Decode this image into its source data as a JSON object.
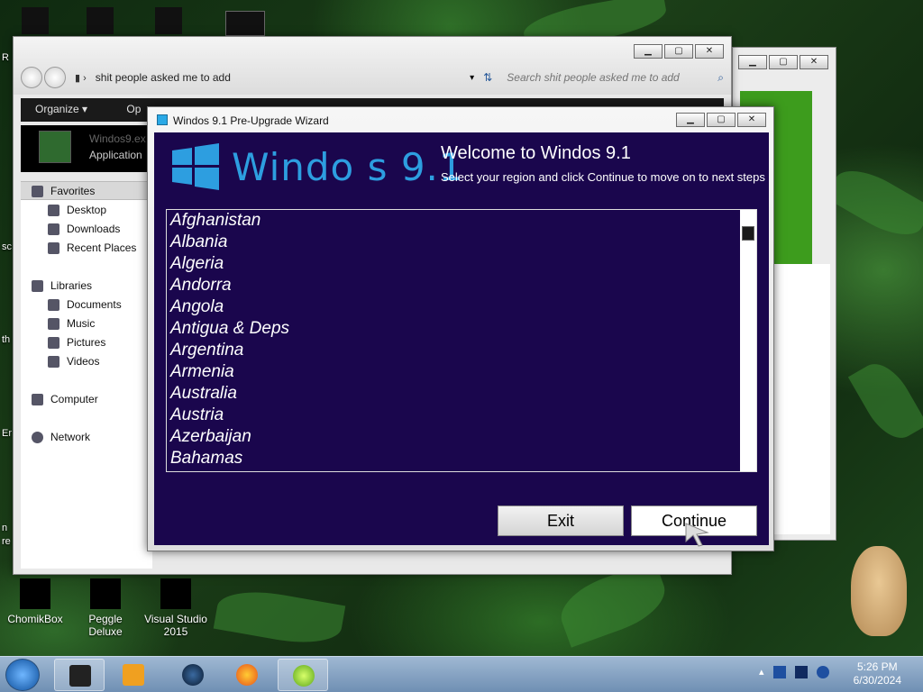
{
  "desktop": {
    "icons": [
      {
        "label": "ChomikBox"
      },
      {
        "label": "Peggle Deluxe"
      },
      {
        "label": "Visual Studio 2015"
      }
    ],
    "edge_text": [
      "R",
      "sc",
      "th",
      "Er",
      "n",
      "re"
    ]
  },
  "explorer": {
    "breadcrumb": "shit people asked me to add",
    "search_placeholder": "Search shit people asked me to add",
    "toolbar": {
      "organize": "Organize",
      "open": "Op"
    },
    "detail": {
      "name": "Windos9.ex",
      "type": "Application"
    },
    "sidebar": {
      "favorites": "Favorites",
      "favorite_items": [
        "Desktop",
        "Downloads",
        "Recent Places"
      ],
      "libraries": "Libraries",
      "library_items": [
        "Documents",
        "Music",
        "Pictures",
        "Videos"
      ],
      "computer": "Computer",
      "network": "Network"
    }
  },
  "wizard": {
    "title": "Windos 9.1 Pre-Upgrade Wizard",
    "logo_text": "Windo  s 9.1",
    "heading": "Welcome to Windos 9.1",
    "subtitle": "Select your region and click Continue to move on to next steps",
    "countries": [
      "Afghanistan",
      "Albania",
      "Algeria",
      "Andorra",
      "Angola",
      "Antigua & Deps",
      "Argentina",
      "Armenia",
      "Australia",
      "Austria",
      "Azerbaijan",
      "Bahamas"
    ],
    "exit_label": "Exit",
    "continue_label": "Continue"
  },
  "taskbar": {
    "time": "5:26 PM",
    "date": "6/30/2024"
  },
  "colors": {
    "wizard_bg": "#1a064d",
    "logo_blue": "#2d9ee0",
    "taskbar": "#7d9bbd"
  }
}
